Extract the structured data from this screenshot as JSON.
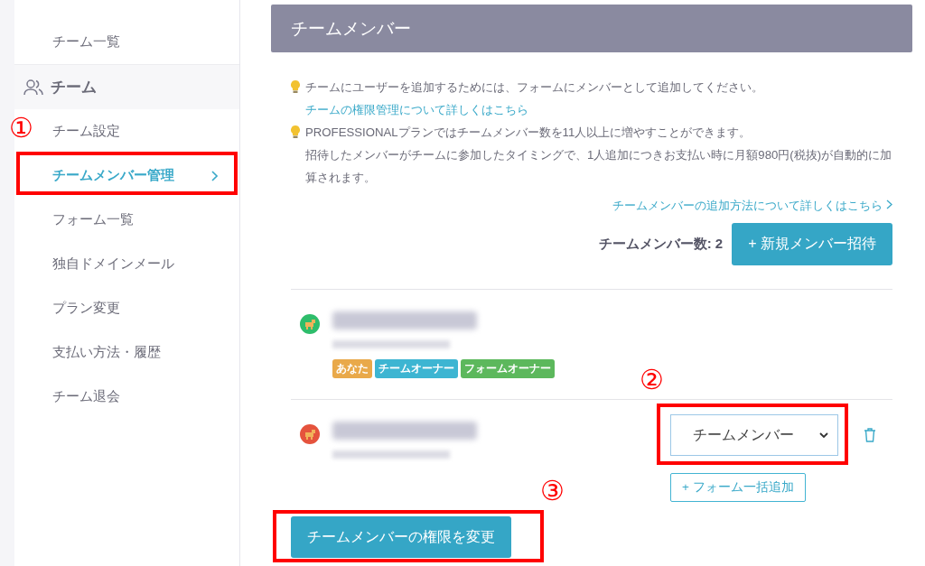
{
  "sidebar": {
    "items": [
      {
        "label": "チーム一覧",
        "selected": false
      }
    ],
    "section": {
      "title": "チーム",
      "items": [
        {
          "label": "チーム設定",
          "selected": false
        },
        {
          "label": "チームメンバー管理",
          "selected": true
        },
        {
          "label": "フォーム一覧",
          "selected": false
        },
        {
          "label": "独自ドメインメール",
          "selected": false
        },
        {
          "label": "プラン変更",
          "selected": false
        },
        {
          "label": "支払い方法・履歴",
          "selected": false
        },
        {
          "label": "チーム退会",
          "selected": false
        }
      ]
    }
  },
  "panel": {
    "title": "チームメンバー",
    "notes": [
      {
        "lines": [
          "チームにユーザーを追加するためには、フォームにメンバーとして追加してください。"
        ],
        "link": "チームの権限管理について詳しくはこちら"
      },
      {
        "lines": [
          "PROFESSIONALプランではチームメンバー数を11人以上に増やすことができます。",
          "招待したメンバーがチームに参加したタイミングで、1人追加につきお支払い時に月額980円(税抜)が自動的に加算されます。"
        ]
      }
    ],
    "help_link": "チームメンバーの追加方法について詳しくはこちら",
    "member_count": "チームメンバー数: 2",
    "invite_button": "+ 新規メンバー招待",
    "members": [
      {
        "kind": "self",
        "color": "#2ebd6b",
        "badges": [
          {
            "label": "あなた",
            "color": "#e9a94a"
          },
          {
            "label": "チームオーナー",
            "color": "#3db5d2"
          },
          {
            "label": "フォームオーナー",
            "color": "#5cb85c"
          }
        ]
      },
      {
        "kind": "member",
        "color": "#e5533d",
        "role": "チームメンバー",
        "bulk_add": "+ フォーム一括追加"
      }
    ],
    "change_button": "チームメンバーの権限を変更"
  },
  "annotations": [
    {
      "label": "①"
    },
    {
      "label": "②"
    },
    {
      "label": "③"
    }
  ]
}
